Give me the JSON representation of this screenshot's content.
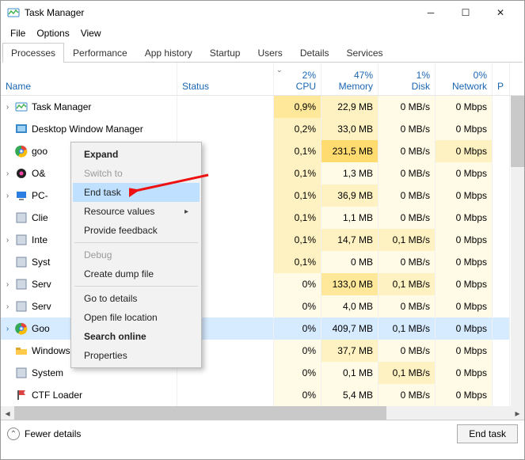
{
  "window": {
    "title": "Task Manager"
  },
  "menubar": [
    "File",
    "Options",
    "View"
  ],
  "tabs": [
    "Processes",
    "Performance",
    "App history",
    "Startup",
    "Users",
    "Details",
    "Services"
  ],
  "active_tab": 0,
  "columns": {
    "name": "Name",
    "status": "Status",
    "cpu": {
      "pct": "2%",
      "label": "CPU"
    },
    "mem": {
      "pct": "47%",
      "label": "Memory"
    },
    "disk": {
      "pct": "1%",
      "label": "Disk"
    },
    "net": {
      "pct": "0%",
      "label": "Network"
    },
    "p": "P"
  },
  "processes": [
    {
      "expand": true,
      "icon": "taskmgr",
      "name": "Task Manager",
      "cpu": "0,9%",
      "mem": "22,9 MB",
      "disk": "0 MB/s",
      "net": "0 Mbps",
      "h": {
        "cpu": "h2",
        "mem": "h1",
        "disk": "h0",
        "net": "h0"
      }
    },
    {
      "expand": false,
      "icon": "dwm",
      "name": "Desktop Window Manager",
      "cpu": "0,2%",
      "mem": "33,0 MB",
      "disk": "0 MB/s",
      "net": "0 Mbps",
      "h": {
        "cpu": "h1",
        "mem": "h1",
        "disk": "h0",
        "net": "h0"
      }
    },
    {
      "expand": false,
      "icon": "goo",
      "name": "goo",
      "cpu": "0,1%",
      "mem": "231,5 MB",
      "disk": "0 MB/s",
      "net": "0 Mbps",
      "h": {
        "cpu": "h1",
        "mem": "h3",
        "disk": "h0",
        "net": "h1"
      }
    },
    {
      "expand": true,
      "icon": "ou",
      "name": "O&",
      "cpu": "0,1%",
      "mem": "1,3 MB",
      "disk": "0 MB/s",
      "net": "0 Mbps",
      "h": {
        "cpu": "h1",
        "mem": "h0",
        "disk": "h0",
        "net": "h0"
      }
    },
    {
      "expand": true,
      "icon": "pc",
      "name": "PC-",
      "cpu": "0,1%",
      "mem": "36,9 MB",
      "disk": "0 MB/s",
      "net": "0 Mbps",
      "h": {
        "cpu": "h1",
        "mem": "h1",
        "disk": "h0",
        "net": "h0"
      }
    },
    {
      "expand": false,
      "icon": "clie",
      "name": "Clie",
      "cpu": "0,1%",
      "mem": "1,1 MB",
      "disk": "0 MB/s",
      "net": "0 Mbps",
      "h": {
        "cpu": "h1",
        "mem": "h0",
        "disk": "h0",
        "net": "h0"
      }
    },
    {
      "expand": true,
      "icon": "inte",
      "name": "Inte",
      "cpu": "0,1%",
      "mem": "14,7 MB",
      "disk": "0,1 MB/s",
      "net": "0 Mbps",
      "h": {
        "cpu": "h1",
        "mem": "h1",
        "disk": "h1",
        "net": "h0"
      }
    },
    {
      "expand": false,
      "icon": "syst",
      "name": "Syst",
      "cpu": "0,1%",
      "mem": "0 MB",
      "disk": "0 MB/s",
      "net": "0 Mbps",
      "h": {
        "cpu": "h1",
        "mem": "h0",
        "disk": "h0",
        "net": "h0"
      }
    },
    {
      "expand": true,
      "icon": "serv",
      "name": "Serv",
      "cpu": "0%",
      "mem": "133,0 MB",
      "disk": "0,1 MB/s",
      "net": "0 Mbps",
      "h": {
        "cpu": "h0",
        "mem": "h2",
        "disk": "h1",
        "net": "h0"
      }
    },
    {
      "expand": true,
      "icon": "serv",
      "name": "Serv",
      "cpu": "0%",
      "mem": "4,0 MB",
      "disk": "0 MB/s",
      "net": "0 Mbps",
      "h": {
        "cpu": "h0",
        "mem": "h0",
        "disk": "h0",
        "net": "h0"
      }
    },
    {
      "expand": true,
      "icon": "goo2",
      "name": "Goo",
      "cpu": "0%",
      "mem": "409,7 MB",
      "disk": "0,1 MB/s",
      "net": "0 Mbps",
      "selected": true,
      "h": {
        "cpu": "",
        "mem": "",
        "disk": "",
        "net": ""
      }
    },
    {
      "expand": false,
      "icon": "explorer",
      "name": "Windows Explorer",
      "cpu": "0%",
      "mem": "37,7 MB",
      "disk": "0 MB/s",
      "net": "0 Mbps",
      "h": {
        "cpu": "h0",
        "mem": "h1",
        "disk": "h0",
        "net": "h0"
      }
    },
    {
      "expand": false,
      "icon": "system",
      "name": "System",
      "cpu": "0%",
      "mem": "0,1 MB",
      "disk": "0,1 MB/s",
      "net": "0 Mbps",
      "h": {
        "cpu": "h0",
        "mem": "h0",
        "disk": "h1",
        "net": "h0"
      }
    },
    {
      "expand": false,
      "icon": "ctf",
      "name": "CTF Loader",
      "cpu": "0%",
      "mem": "5,4 MB",
      "disk": "0 MB/s",
      "net": "0 Mbps",
      "h": {
        "cpu": "h0",
        "mem": "h0",
        "disk": "h0",
        "net": "h0"
      }
    }
  ],
  "context_menu": [
    {
      "label": "Expand",
      "bold": true
    },
    {
      "label": "Switch to",
      "disabled": true
    },
    {
      "label": "End task",
      "highlight": true
    },
    {
      "label": "Resource values",
      "submenu": true
    },
    {
      "label": "Provide feedback"
    },
    {
      "sep": true
    },
    {
      "label": "Debug",
      "disabled": true
    },
    {
      "label": "Create dump file"
    },
    {
      "sep": true
    },
    {
      "label": "Go to details"
    },
    {
      "label": "Open file location"
    },
    {
      "label": "Search online",
      "bold": true
    },
    {
      "label": "Properties"
    }
  ],
  "footer": {
    "fewer": "Fewer details",
    "endtask": "End task"
  }
}
